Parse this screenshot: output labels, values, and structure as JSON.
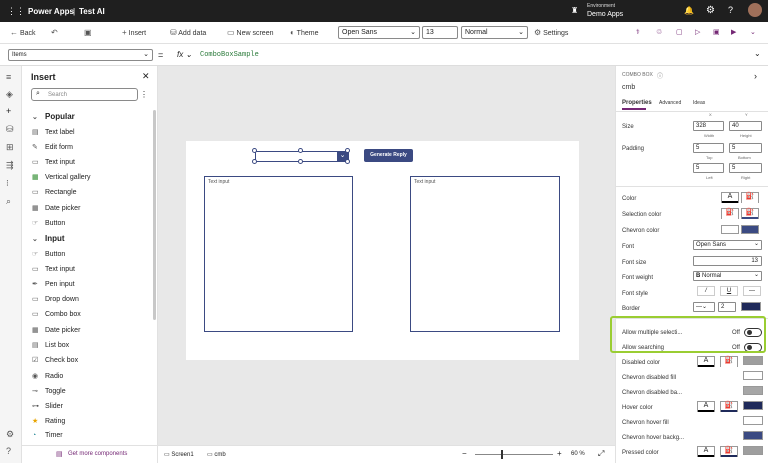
{
  "topbar": {
    "app": "Power Apps",
    "separator": "|",
    "project": "Test AI",
    "env_label": "Environment",
    "env_name": "Demo Apps"
  },
  "cmdbar": {
    "back": "Back",
    "insert": "Insert",
    "add_data": "Add data",
    "new_screen": "New screen",
    "theme": "Theme",
    "font": "Open Sans",
    "font_size": "13",
    "font_weight": "Normal",
    "settings": "Settings"
  },
  "formula": {
    "property": "Items",
    "fx": "fx",
    "value": "ComboBoxSample"
  },
  "insert_panel": {
    "title": "Insert",
    "search_placeholder": "Search",
    "popular_header": "Popular",
    "popular": [
      "Text label",
      "Edit form",
      "Text input",
      "Vertical gallery",
      "Rectangle",
      "Date picker",
      "Button"
    ],
    "input_header": "Input",
    "input": [
      "Button",
      "Text input",
      "Pen input",
      "Drop down",
      "Combo box",
      "Date picker",
      "List box",
      "Check box",
      "Radio",
      "Toggle",
      "Slider",
      "Rating",
      "Timer"
    ],
    "footer": "Get more components"
  },
  "canvas": {
    "button_label": "Generate Reply",
    "input_left": "Text input",
    "input_right": "Text input"
  },
  "status": {
    "screen_tab": "Screen1",
    "control_tab": "cmb",
    "zoom": "60",
    "zoom_unit": "%"
  },
  "props": {
    "type": "COMBO BOX",
    "name": "cmb",
    "tabs": [
      "Properties",
      "Advanced",
      "Ideas"
    ],
    "size_label": "Size",
    "x_label": "X",
    "y_label": "Y",
    "width": "328",
    "height": "40",
    "width_label": "Width",
    "height_label": "Height",
    "padding_label": "Padding",
    "pad_top": "5",
    "pad_bottom": "5",
    "pad_left": "5",
    "pad_right": "5",
    "top_label": "Top",
    "bottom_label": "Bottom",
    "left_label": "Left",
    "right_label": "Right",
    "color": "Color",
    "selection_color": "Selection color",
    "chevron_color": "Chevron color",
    "font": "Font",
    "font_value": "Open Sans",
    "font_size": "Font size",
    "font_size_value": "13",
    "font_weight": "Font weight",
    "font_weight_value": "Normal",
    "font_style": "Font style",
    "border": "Border",
    "border_value": "2",
    "allow_multiple": "Allow multiple selecti...",
    "allow_multiple_state": "Off",
    "allow_searching": "Allow searching",
    "allow_searching_state": "Off",
    "disabled_color": "Disabled color",
    "chevron_disabled_fill": "Chevron disabled fill",
    "chevron_disabled_bg": "Chevron disabled ba...",
    "hover_color": "Hover color",
    "chevron_hover_fill": "Chevron hover fill",
    "chevron_hover_bg": "Chevron hover backg...",
    "pressed_color": "Pressed color"
  },
  "colors": {
    "accent": "#3b4a82",
    "topbar": "#1f1f1f",
    "purple": "#742774",
    "highlight": "#9acd32"
  }
}
